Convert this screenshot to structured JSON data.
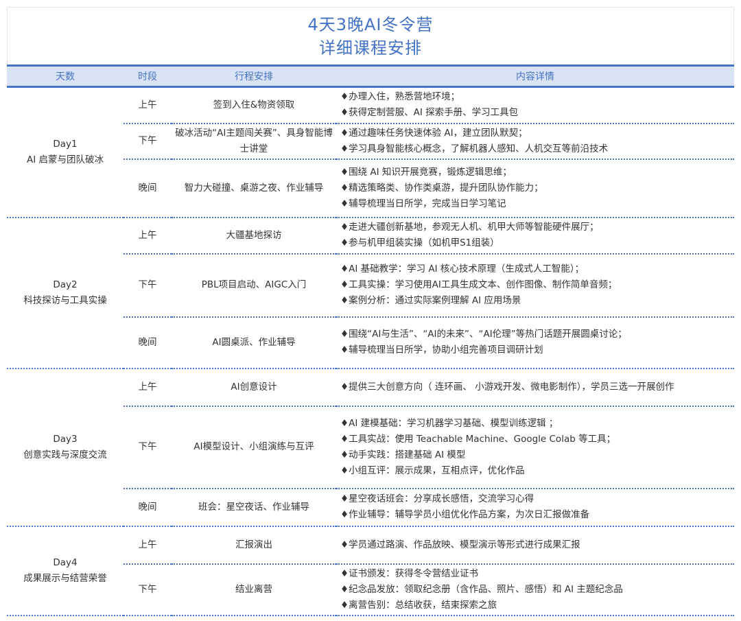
{
  "title": {
    "line1": "4天3晚AI冬令营",
    "line2": "详细课程安排"
  },
  "headers": {
    "day": "天数",
    "period": "时段",
    "activity": "行程安排",
    "details": "内容详情"
  },
  "colors": {
    "accent": "#4472c4",
    "header_bg": "#dae3f3"
  },
  "bullet": "♦",
  "days": [
    {
      "day": "Day1",
      "theme": "AI 启蒙与团队破冰",
      "periods": [
        {
          "period": "上午",
          "activity": "签到入住&物资领取",
          "details": [
            "办理入住，熟悉营地环境；",
            "获得定制营服、AI 探索手册、学习工具包"
          ]
        },
        {
          "period": "下午",
          "activity": "破冰活动“AI主题闯关赛”、具身智能博士讲堂",
          "details": [
            "通过趣味任务快速体验 AI，建立团队默契；",
            "学习具身智能核心概念，了解机器人感知、人机交互等前沿技术"
          ]
        },
        {
          "period": "晚间",
          "activity": "智力大碰撞、桌游之夜、作业辅导",
          "details": [
            "围绕 AI 知识开展竞赛，锻炼逻辑思维；",
            "精选策略类、协作类桌游，提升团队协作能力；",
            "辅导梳理当日所学，完成当日学习笔记"
          ]
        }
      ]
    },
    {
      "day": "Day2",
      "theme": "科技探访与工具实操",
      "periods": [
        {
          "period": "上午",
          "activity": "大疆基地探访",
          "details": [
            "走进大疆创新基地，参观无人机、机甲大师等智能硬件展厅；",
            "参与机甲组装实操（如机甲S1组装）"
          ]
        },
        {
          "period": "下午",
          "activity": "PBL项目启动、AIGC入门",
          "details": [
            "AI 基础教学：学习 AI 核心技术原理（生成式人工智能）；",
            "工具实操：学习使用AI工具生成文本、创作图像、制作简单音频；",
            "案例分析：通过实际案例理解 AI 应用场景"
          ]
        },
        {
          "period": "晚间",
          "activity": "AI圆桌派、作业辅导",
          "details": [
            "围绕“AI与生活”、“AI的未来”、“AI伦理”等热门话题开展圆桌讨论；",
            "辅导梳理当日所学，协助小组完善项目调研计划"
          ]
        }
      ]
    },
    {
      "day": "Day3",
      "theme": "创意实践与深度交流",
      "periods": [
        {
          "period": "上午",
          "activity": "AI创意设计",
          "details": [
            "提供三大创意方向（ 连环画、 小游戏开发、微电影制作），学员三选一开展创作"
          ]
        },
        {
          "period": "下午",
          "activity": "AI模型设计、小组演练与互评",
          "details": [
            "AI 建模基础：学习机器学习基础、模型训练逻辑 ；",
            "工具实战：使用 Teachable Machine、Google Colab 等工具；",
            "动手实践：搭建基础 AI 模型",
            "小组互评：展示成果，互相点评，优化作品"
          ]
        },
        {
          "period": "晚间",
          "activity": "班会：星空夜话、作业辅导",
          "details": [
            "星空夜话班会：分享成长感悟，交流学习心得",
            "作业辅导：辅导学员小组优化作品方案，为次日汇报做准备"
          ]
        }
      ]
    },
    {
      "day": "Day4",
      "theme": "成果展示与结营荣誉",
      "periods": [
        {
          "period": "上午",
          "activity": "汇报演出",
          "details": [
            "学员通过路演、作品放映、模型演示等形式进行成果汇报"
          ]
        },
        {
          "period": "下午",
          "activity": "结业离营",
          "details": [
            "证书颁发：获得冬令营结业证书",
            "纪念品发放：领取纪念册（含作品、照片、感悟）和 AI 主题纪念品",
            "离营告别：总结收获，结束探索之旅"
          ]
        }
      ]
    }
  ]
}
